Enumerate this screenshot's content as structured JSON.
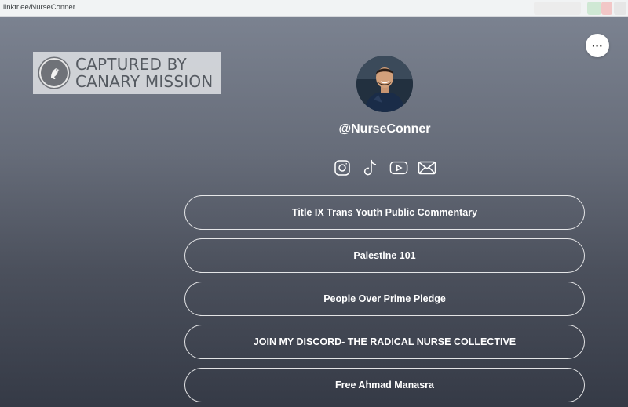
{
  "browser": {
    "url": "linktr.ee/NurseConner"
  },
  "watermark": {
    "line1": "CAPTURED BY",
    "line2": "CANARY MISSION"
  },
  "profile": {
    "username": "@NurseConner"
  },
  "socials": [
    {
      "icon": "instagram-icon"
    },
    {
      "icon": "tiktok-icon"
    },
    {
      "icon": "youtube-icon"
    },
    {
      "icon": "email-icon"
    }
  ],
  "links": [
    {
      "label": "Title IX Trans Youth Public Commentary"
    },
    {
      "label": "Palestine 101"
    },
    {
      "label": "People Over Prime Pledge"
    },
    {
      "label": "JOIN MY DISCORD- THE RADICAL NURSE COLLECTIVE"
    },
    {
      "label": "Free Ahmad Manasra"
    }
  ],
  "menu": {
    "more_label": "···"
  }
}
